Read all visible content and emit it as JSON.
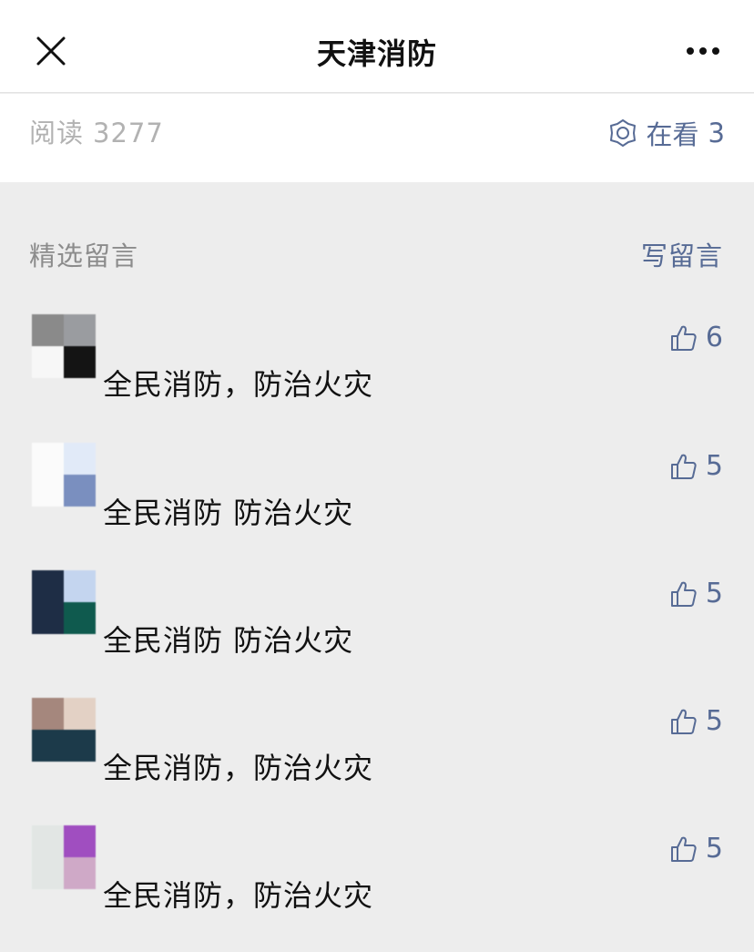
{
  "navbar": {
    "title": "天津消防",
    "close_icon": "close-icon",
    "more_icon": "more-dots-icon"
  },
  "stats": {
    "read_label": "阅读",
    "read_count": "3277",
    "watching_icon": "watching-icon",
    "watching_label": "在看",
    "watching_count": "3"
  },
  "comments_section": {
    "title": "精选留言",
    "write_label": "写留言"
  },
  "comments": [
    {
      "text": "全民消防，防治火灾",
      "likes": "6",
      "avatar_colors": [
        "#8a8a8a",
        "#9a9ca0",
        "#f7f7f7",
        "#141414"
      ]
    },
    {
      "text": "全民消防 防治火灾",
      "likes": "5",
      "avatar_colors": [
        "#fbfbfb",
        "#e1eaf8",
        "#fbfbfb",
        "#7a8fbf"
      ]
    },
    {
      "text": "全民消防 防治火灾",
      "likes": "5",
      "avatar_colors": [
        "#1e2d45",
        "#c4d5ef",
        "#1e2d45",
        "#0f5a4e"
      ]
    },
    {
      "text": "全民消防，防治火灾",
      "likes": "5",
      "avatar_colors": [
        "#a5877d",
        "#e3d1c5",
        "#1c3a4a",
        "#1c3a4a"
      ]
    },
    {
      "text": "全民消防，防治火灾",
      "likes": "5",
      "avatar_colors": [
        "#e2e6e4",
        "#a04ec0",
        "#e2e6e4",
        "#cfa9c7"
      ]
    }
  ],
  "colors": {
    "link": "#576b95",
    "muted": "#b2b2b2",
    "section_bg": "#ededed"
  }
}
